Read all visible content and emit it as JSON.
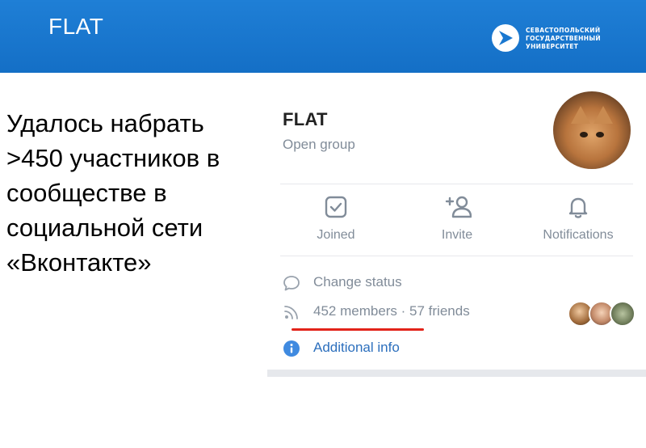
{
  "slide": {
    "title": "FLAT",
    "logo": {
      "lines": [
        "СЕВАСТОПОЛЬСКИЙ",
        "ГОСУДАРСТВЕННЫЙ",
        "УНИВЕРСИТЕТ"
      ],
      "icon": "arrow-logo-icon"
    },
    "caption": "Удалось набрать >450 участников в сообществе в социальной сети «Вконтакте»"
  },
  "group": {
    "name": "FLAT",
    "type": "Open group",
    "avatar_icon": "kitten-avatar"
  },
  "actions": [
    {
      "label": "Joined",
      "icon": "checkbox-checked-icon"
    },
    {
      "label": "Invite",
      "icon": "add-user-icon"
    },
    {
      "label": "Notifications",
      "icon": "bell-icon"
    }
  ],
  "info": {
    "status": {
      "label": "Change status",
      "icon": "speech-bubble-icon"
    },
    "members": {
      "label": "452 members · 57 friends",
      "icon": "rss-feed-icon"
    },
    "additional": {
      "label": "Additional info",
      "icon": "info-circle-icon"
    }
  },
  "colors": {
    "header_blue": "#1a78d0",
    "accent_blue": "#2c6fbd",
    "muted_gray": "#818c99",
    "underline_red": "#e2231a"
  }
}
